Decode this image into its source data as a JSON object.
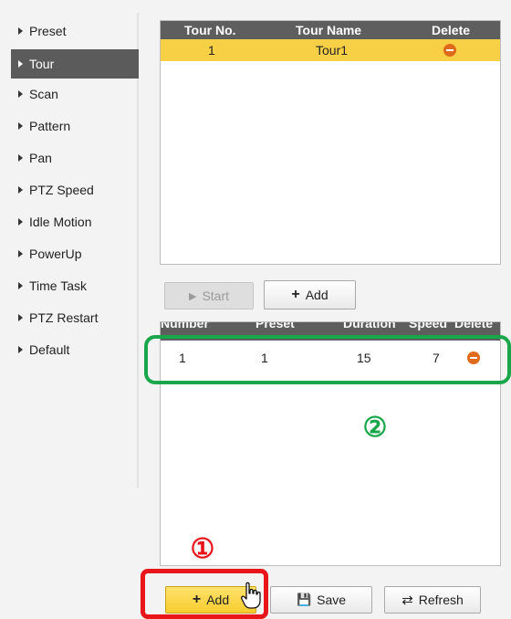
{
  "sidebar": {
    "items": [
      {
        "label": "Preset"
      },
      {
        "label": "Tour"
      },
      {
        "label": "Scan"
      },
      {
        "label": "Pattern"
      },
      {
        "label": "Pan"
      },
      {
        "label": "PTZ Speed"
      },
      {
        "label": "Idle Motion"
      },
      {
        "label": "PowerUp"
      },
      {
        "label": "Time Task"
      },
      {
        "label": "PTZ Restart"
      },
      {
        "label": "Default"
      }
    ],
    "active": "Tour"
  },
  "tour_table": {
    "headers": {
      "no": "Tour No.",
      "name": "Tour Name",
      "delete": "Delete"
    },
    "rows": [
      {
        "no": "1",
        "name": "Tour1"
      }
    ]
  },
  "tour_buttons": {
    "start_label": "Start",
    "add_label": "Add"
  },
  "preset_table": {
    "headers": {
      "number": "Number",
      "preset": "Preset",
      "duration": "Duration",
      "speed": "Speed",
      "delete": "Delete"
    },
    "rows": [
      {
        "number": "1",
        "preset": "1",
        "duration": "15",
        "speed": "7"
      }
    ]
  },
  "bottom_buttons": {
    "add_label": "Add",
    "save_label": "Save",
    "refresh_label": "Refresh"
  },
  "annotations": {
    "step1": "①",
    "step2": "②"
  },
  "colors": {
    "selected_row": "#f7d046",
    "header_bg": "#5e5e5e",
    "sidebar_active": "#5b5b5b",
    "highlight_red": "#e8151a",
    "highlight_green": "#1aa64a",
    "delete_icon": "#e06a1b"
  }
}
